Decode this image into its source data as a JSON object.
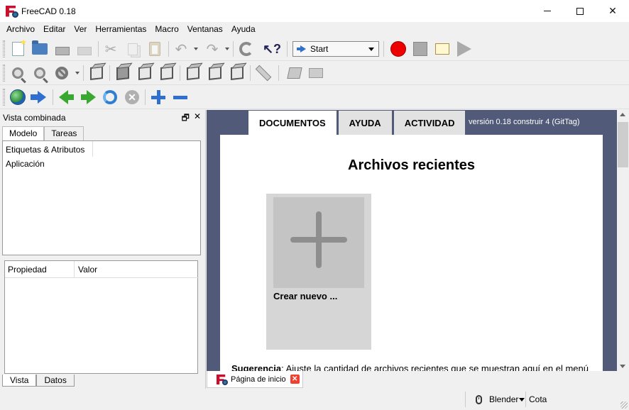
{
  "window": {
    "title": "FreeCAD 0.18",
    "icon": "freecad-logo-icon",
    "controls": [
      "minimize-icon",
      "maximize-icon",
      "close-icon"
    ]
  },
  "menubar": {
    "items": [
      "Archivo",
      "Editar",
      "Ver",
      "Herramientas",
      "Macro",
      "Ventanas",
      "Ayuda"
    ]
  },
  "toolbar": {
    "workbench_selected": "Start"
  },
  "combo_view": {
    "title": "Vista combinada",
    "tabs": [
      "Modelo",
      "Tareas"
    ],
    "tree_header": "Etiquetas & Atributos",
    "tree_items": [
      "Aplicación"
    ],
    "property_headers": [
      "Propiedad",
      "Valor"
    ],
    "bottom_tabs": [
      "Vista",
      "Datos"
    ]
  },
  "start_page": {
    "tabs": [
      "DOCUMENTOS",
      "AYUDA",
      "ACTIVIDAD"
    ],
    "version": "versión 0.18 construir 4 (GitTag)",
    "recent_title": "Archivos recientes",
    "new_file_label": "Crear nuevo ...",
    "hint_bold": "Sugerencia",
    "hint_text": ": Ajuste la cantidad de archivos recientes que se muestran aquí en el menú",
    "bg_color": "#515a78"
  },
  "document_tabs": [
    {
      "label": "Página de inicio"
    }
  ],
  "statusbar": {
    "navigation_style": "Blender",
    "units": "Cota"
  }
}
